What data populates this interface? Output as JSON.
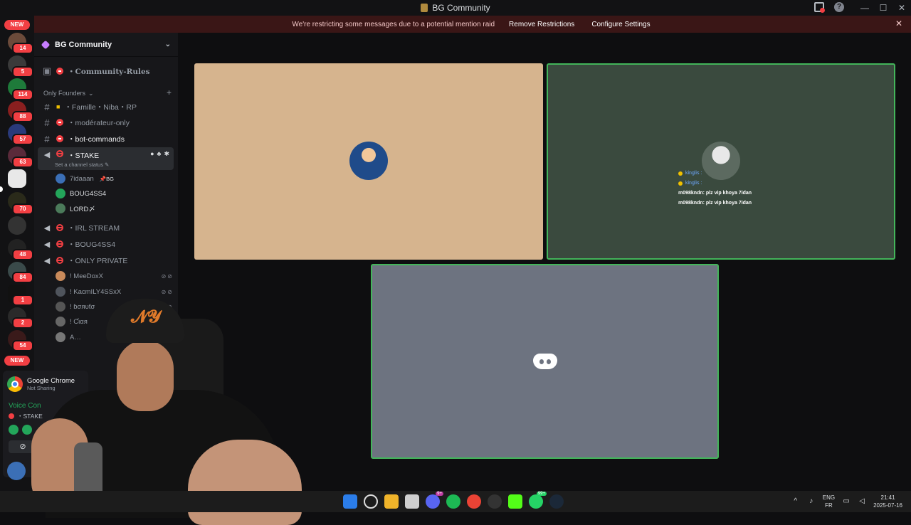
{
  "window": {
    "title": "BG Community",
    "controls": [
      "—",
      "☐",
      "✕"
    ]
  },
  "banner": {
    "text": "We're restricting some messages due to a potential mention raid",
    "remove_label": "Remove Restrictions",
    "configure_label": "Configure Settings",
    "close": "✕"
  },
  "rail": {
    "new_label_top": "NEW",
    "new_label_bottom": "NEW",
    "badges": [
      "14",
      "5",
      "114",
      "88",
      "57",
      "63",
      "70",
      "48",
      "84",
      "1",
      "2",
      "54"
    ]
  },
  "sidebar": {
    "guild_name": "BG Community",
    "chevron": "⌄",
    "channels": {
      "rules": "・Community-Rules",
      "category": "Only Founders",
      "famille": "・Famille・Niba・RP",
      "moderateur": "・modérateur-only",
      "bot_commands": "・bot-commands",
      "stake": "・STAKE",
      "stake_status": "Set a channel status ✎",
      "irl": "・IRL STREAM",
      "boug": "・BOUG4SS4",
      "only_private": "・ONLY PRIVATE"
    },
    "stake_users": [
      {
        "name": "7idaaan",
        "tag": "📌BG"
      },
      {
        "name": "BOUG4SS4",
        "tag": ""
      },
      {
        "name": "LORD〆",
        "tag": ""
      }
    ],
    "private_users": [
      {
        "name": "! MeeDoxX"
      },
      {
        "name": "! KacmILY4SSxX"
      },
      {
        "name": "! ɓσяυƭσ"
      },
      {
        "name": "! Ƈιαя"
      },
      {
        "name": "A…"
      }
    ]
  },
  "voice_panel": {
    "app_name": "Google Chrome",
    "app_status": "Not Sharing",
    "connected_label": "Voice Con",
    "channel_label": "・STAKE"
  },
  "stage": {
    "chat_lines": [
      {
        "user": "kinglis :",
        "text": ""
      },
      {
        "user": "kinglis :",
        "text": ""
      },
      {
        "user": "m098kndn",
        "text": ": plz vip khoya 7idan"
      },
      {
        "user": "m098kndn",
        "text": ": plz vip khoya 7idan"
      }
    ]
  },
  "taskbar": {
    "lang_top": "ENG",
    "lang_bottom": "FR",
    "time": "21:41",
    "date": "2025-07-16",
    "badge_discord": "9+",
    "badge_whatsapp": "99+"
  },
  "colors": {
    "accent_green": "#43b55a",
    "danger": "#f23f43",
    "tile_user1": "#d6b48e",
    "tile_user2": "#3a4a3e",
    "tile_user3": "#6d7380"
  }
}
